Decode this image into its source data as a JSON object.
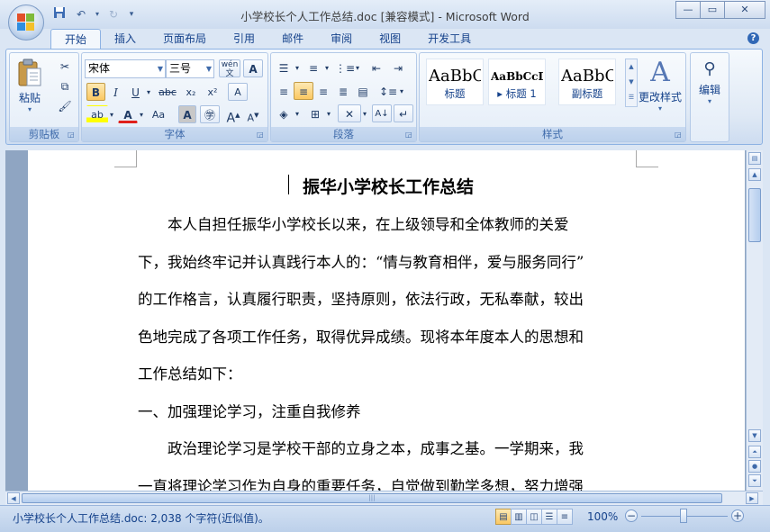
{
  "window": {
    "title": "小学校长个人工作总结.doc [兼容模式] - Microsoft Word"
  },
  "qat": {
    "icons": [
      "save-icon",
      "undo-icon",
      "redo-icon",
      "customize-icon"
    ]
  },
  "tabs": [
    "开始",
    "插入",
    "页面布局",
    "引用",
    "邮件",
    "审阅",
    "视图",
    "开发工具"
  ],
  "ribbon": {
    "clipboard": {
      "label": "剪贴板",
      "paste": "粘贴"
    },
    "font": {
      "label": "字体",
      "font_name": "宋体",
      "font_size": "三号",
      "wen_label": "wén",
      "bold": "B",
      "italic": "I",
      "underline": "U",
      "strike": "abc",
      "subscript": "x₂",
      "superscript": "x²",
      "clear_format": "A",
      "font_color": "A",
      "change_case": "Aa",
      "grow": "A",
      "shrink": "A"
    },
    "paragraph": {
      "label": "段落"
    },
    "styles": {
      "label": "样式",
      "items": [
        {
          "sample": "AaBbC",
          "name": "标题"
        },
        {
          "sample": "AaBbCcDd",
          "name": "标题 1"
        },
        {
          "sample": "AaBbC",
          "name": "副标题"
        }
      ],
      "change_styles": "更改样式"
    },
    "editing": {
      "label": "编辑"
    }
  },
  "document": {
    "title": "振华小学校长工作总结",
    "lines": [
      "　　本人自担任振华小学校长以来，在上级领导和全体教师的关爱",
      "下，我始终牢记并认真践行本人的：“情与教育相伴，爱与服务同行”",
      "的工作格言，认真履行职责，坚持原则，依法行政，无私奉献，较出",
      "色地完成了各项工作任务，取得优异成绩。现将本年度本人的思想和",
      "工作总结如下：",
      "一、加强理论学习，注重自我修养",
      "　　政治理论学习是学校干部的立身之本，成事之基。一学期来，我",
      "一直将理论学习作为自身的重要任务，自觉做到勤学多想，努力增强"
    ]
  },
  "status": {
    "text": "小学校长个人工作总结.doc: 2,038 个字符(近似值)。",
    "zoom": "100%"
  }
}
